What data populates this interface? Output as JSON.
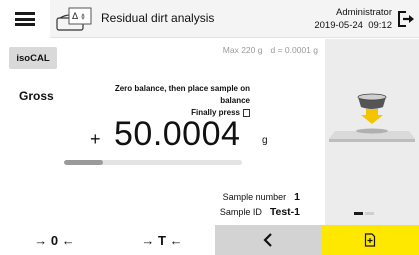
{
  "header": {
    "menu_icon": "hamburger-menu-icon",
    "app_icon": "residual-dirt-app-icon",
    "title": "Residual dirt analysis",
    "user": "Administrator",
    "datetime": "2019-05-24  09:12",
    "logout_icon": "logout-icon"
  },
  "main": {
    "isocal_label": "isoCAL",
    "max_capacity": "Max 220 g",
    "readability": "d = 0.0001 g",
    "mode_label": "Gross",
    "instruction_line1": "Zero balance, then place sample on balance",
    "instruction_line2": "Finally press",
    "sign": "+",
    "weight_value": "50.0004",
    "weight_unit": "g",
    "weighing_progress": 0.22,
    "sample_number_label": "Sample number",
    "sample_number_value": "1",
    "sample_id_label": "Sample ID",
    "sample_id_value": "Test-1"
  },
  "right_panel": {
    "illustration": "place-sample-on-balance-illustration",
    "page_indicator": {
      "pages": 2,
      "active": 1
    }
  },
  "toolbar": {
    "zero_label": "→ 0 ←",
    "tare_label": "→ T ←",
    "back_icon": "chevron-left-icon",
    "ok_icon": "accept-document-icon"
  },
  "colors": {
    "accent_yellow": "#ffe800",
    "back_button_gray": "#d3d3d3",
    "right_panel_gray": "#ececec",
    "header_gray": "#f4f4f4"
  }
}
